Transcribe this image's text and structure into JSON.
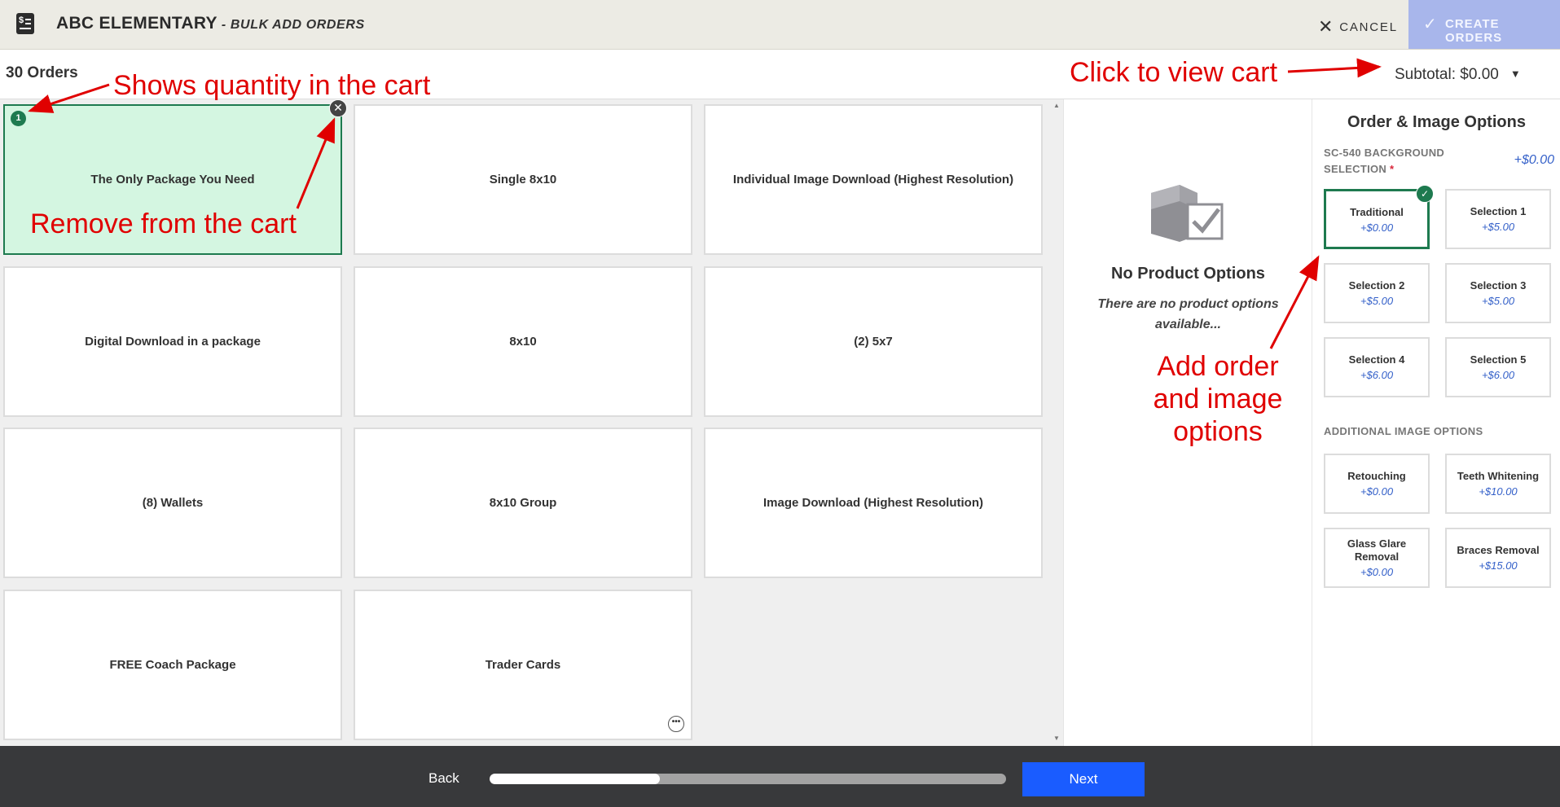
{
  "header": {
    "title": "ABC ELEMENTARY",
    "subtitle": " - BULK ADD ORDERS",
    "cancel_label": "CANCEL",
    "create_label": "CREATE ORDERS"
  },
  "subheader": {
    "orders_count": "30 Orders",
    "subtotal": "Subtotal: $0.00"
  },
  "products": [
    {
      "name": "The Only Package You Need",
      "selected": true,
      "quantity": "1"
    },
    {
      "name": "Single 8x10"
    },
    {
      "name": "Individual Image Download (Highest Resolution)"
    },
    {
      "name": "Digital Download in a package"
    },
    {
      "name": "8x10"
    },
    {
      "name": "(2) 5x7"
    },
    {
      "name": "(8) Wallets"
    },
    {
      "name": "8x10 Group"
    },
    {
      "name": "Image Download (Highest Resolution)"
    },
    {
      "name": "FREE Coach Package"
    },
    {
      "name": "Trader Cards"
    }
  ],
  "middle_panel": {
    "title": "No Product Options",
    "text": "There are no product options available..."
  },
  "right_panel": {
    "title": "Order & Image Options",
    "background_section": "SC-540 BACKGROUND SELECTION",
    "background_price": "+$0.00",
    "background_options": [
      {
        "name": "Traditional",
        "price": "+$0.00",
        "selected": true
      },
      {
        "name": "Selection 1",
        "price": "+$5.00"
      },
      {
        "name": "Selection 2",
        "price": "+$5.00"
      },
      {
        "name": "Selection 3",
        "price": "+$5.00"
      },
      {
        "name": "Selection 4",
        "price": "+$6.00"
      },
      {
        "name": "Selection 5",
        "price": "+$6.00"
      }
    ],
    "additional_section": "ADDITIONAL IMAGE OPTIONS",
    "additional_options": [
      {
        "name": "Retouching",
        "price": "+$0.00"
      },
      {
        "name": "Teeth Whitening",
        "price": "+$10.00"
      },
      {
        "name": "Glass Glare Removal",
        "price": "+$0.00"
      },
      {
        "name": "Braces Removal",
        "price": "+$15.00"
      }
    ]
  },
  "footer": {
    "back_label": "Back",
    "next_label": "Next",
    "progress": 0.33
  },
  "annotations": {
    "quantity": "Shows quantity in the cart",
    "remove": "Remove from the cart",
    "view_cart": "Click to view cart",
    "options_line1": "Add order",
    "options_line2": "and image",
    "options_line3": "options"
  },
  "colors": {
    "accent_green": "#1e7a4f",
    "selected_card_bg": "#d4f6e1",
    "create_button": "#a8b6eb",
    "next_button": "#1a5cff",
    "price_blue": "#3561c9",
    "annotation_red": "#e00000"
  },
  "icons": [
    "receipt-icon",
    "close-icon",
    "check-icon",
    "caret-down-icon",
    "box-check-icon",
    "more-icon"
  ]
}
